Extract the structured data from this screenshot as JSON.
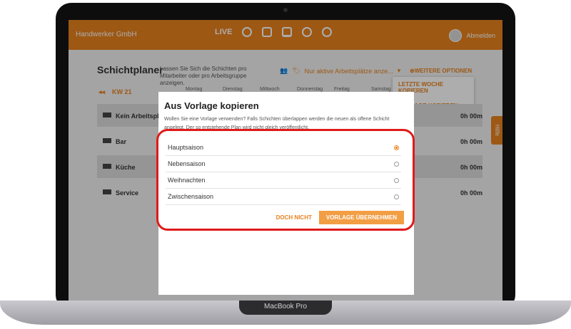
{
  "device": {
    "brand": "MacBook Pro"
  },
  "topbar": {
    "company": "Handwerker GmbH",
    "nav_live": "LIVE",
    "nav_icons": [
      "alarm-icon",
      "list-icon",
      "calendar-icon",
      "hands-icon",
      "gear-icon"
    ],
    "user_action": "Abmelden"
  },
  "page": {
    "title": "Schichtplaner",
    "subtitle": "Lassen Sie Sich die Schichten pro Mitarbeiter oder pro Arbeitsgruppe anzeigen.",
    "filter_label": "Nur aktive Arbeitsplätze anze...",
    "more_options": "⊕WEITERE OPTIONEN",
    "menu_items": [
      "LETZTE WOCHE KOPIEREN",
      "VORLAGE KOPIEREN"
    ],
    "week": "KW 21",
    "days": [
      "Montag",
      "Dienstag",
      "Mittwoch",
      "Donnerstag",
      "Freitag",
      "Samstag"
    ],
    "rows": [
      {
        "label": "Kein Arbeitspla",
        "hours": "0h 00m"
      },
      {
        "label": "Bar",
        "hours": "0h 00m"
      },
      {
        "label": "Küche",
        "hours": "0h 00m"
      },
      {
        "label": "Service",
        "hours": "0h 00m"
      }
    ],
    "help": "Hilfe"
  },
  "dialog": {
    "title": "Aus Vorlage kopieren",
    "description": "Wollen Sie eine Vorlage verwenden? Falls Schichten überlappen werden die neuen als offene Schicht angelegt. Der so entstehende Plan wird nicht gleich veröffentlicht.",
    "options": [
      "Hauptsaison",
      "Nebensaison",
      "Weihnachten",
      "Zwischensaison"
    ],
    "selected_index": 0,
    "cancel_label": "DOCH NICHT",
    "confirm_label": "VORLAGE ÜBERNEHMEN"
  },
  "colors": {
    "accent": "#e8821e",
    "highlight": "#e01a1a"
  }
}
